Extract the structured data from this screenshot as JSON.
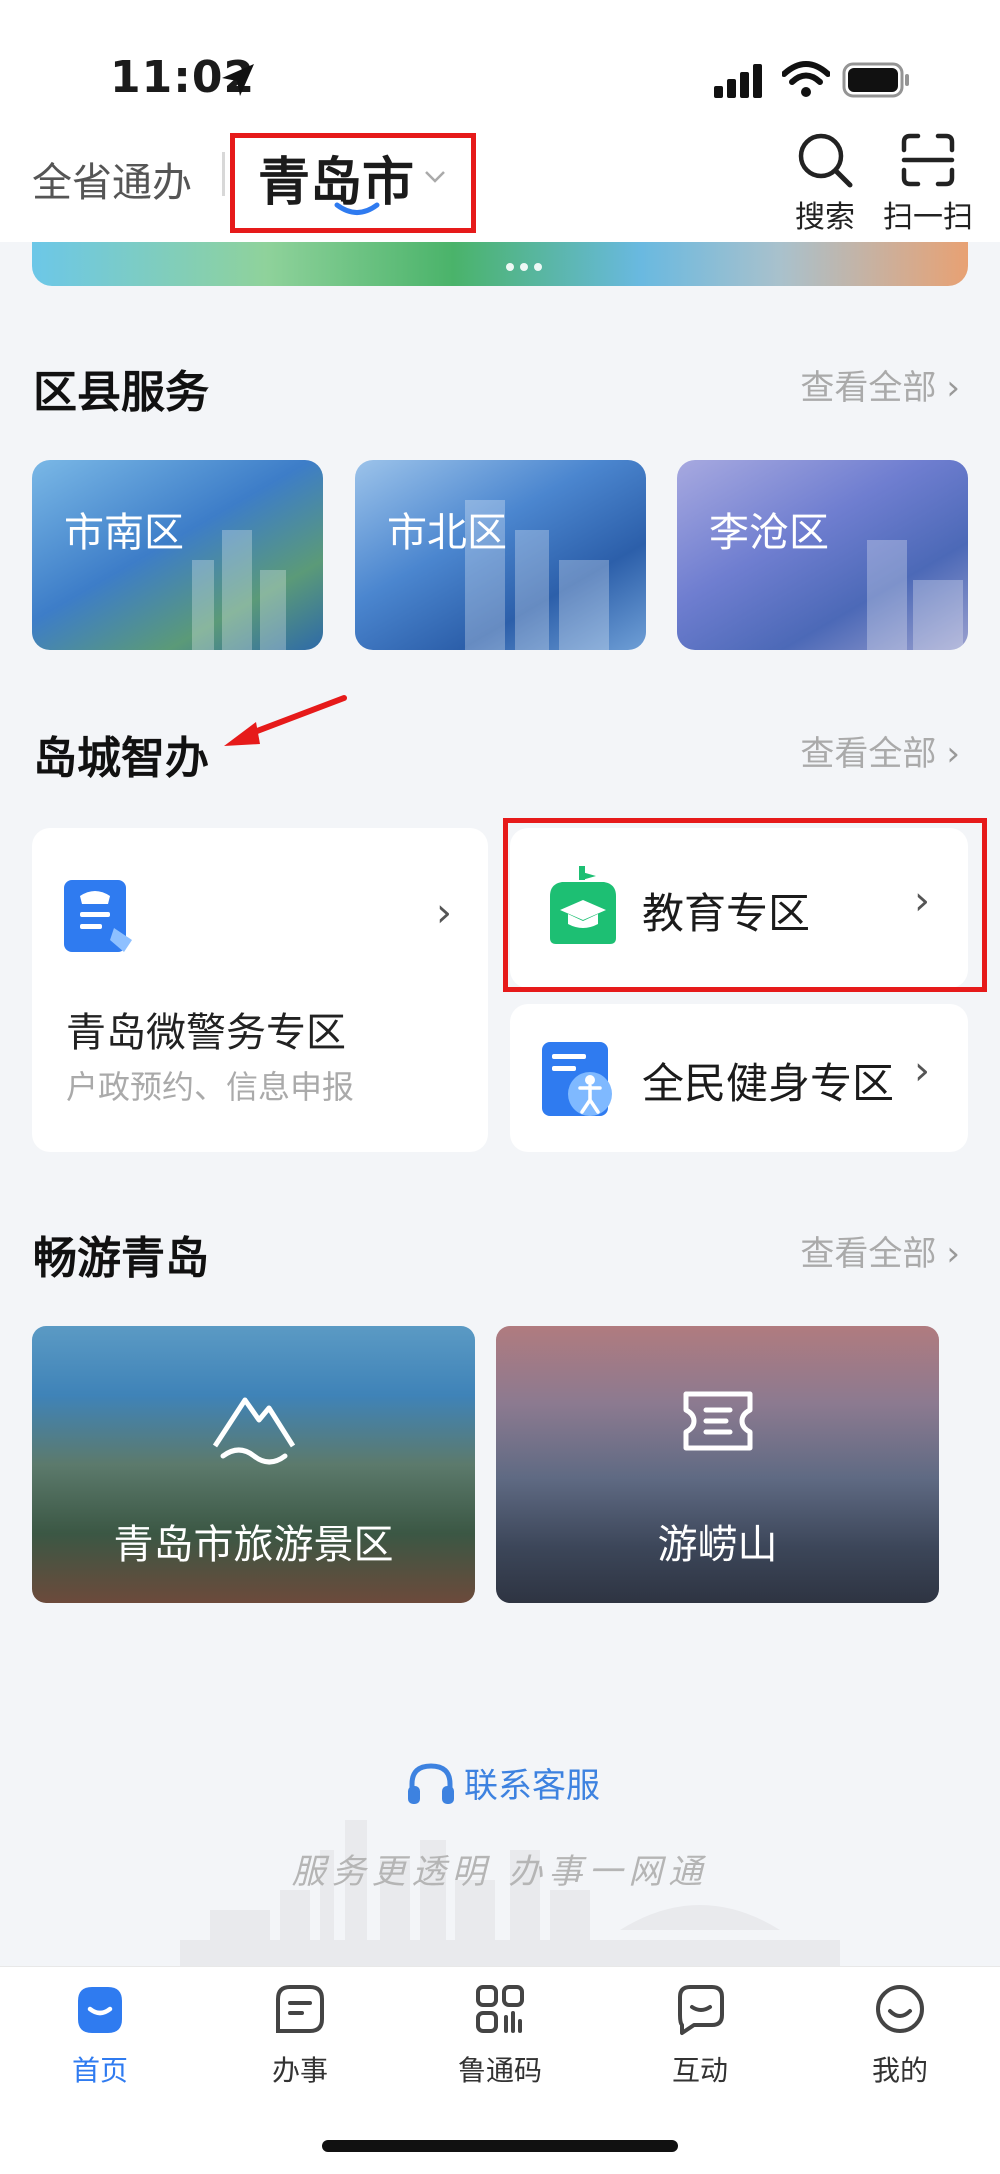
{
  "status_bar": {
    "time": "11:02"
  },
  "top_nav": {
    "province_tab": "全省通办",
    "city_tab": "青岛市",
    "search_label": "搜索",
    "scan_label": "扫一扫"
  },
  "district_section": {
    "title": "区县服务",
    "more": "查看全部",
    "items": [
      {
        "label": "市南区"
      },
      {
        "label": "市北区"
      },
      {
        "label": "李沧区"
      }
    ]
  },
  "zhiban_section": {
    "title": "岛城智办",
    "more": "查看全部",
    "police": {
      "title": "青岛微警务专区",
      "subtitle": "户政预约、信息申报"
    },
    "education": {
      "label": "教育专区"
    },
    "fitness": {
      "label": "全民健身专区"
    }
  },
  "tour_section": {
    "title": "畅游青岛",
    "more": "查看全部",
    "items": [
      {
        "label": "青岛市旅游景区"
      },
      {
        "label": "游崂山"
      }
    ]
  },
  "footer": {
    "service": "联系客服",
    "slogan": "服务更透明 办事一网通"
  },
  "tab_bar": {
    "items": [
      {
        "label": "首页",
        "icon": "home-icon",
        "active": true
      },
      {
        "label": "办事",
        "icon": "service-icon",
        "active": false
      },
      {
        "label": "鲁通码",
        "icon": "qr-code-icon",
        "active": false
      },
      {
        "label": "互动",
        "icon": "chat-icon",
        "active": false
      },
      {
        "label": "我的",
        "icon": "profile-icon",
        "active": false
      }
    ]
  },
  "colors": {
    "accent": "#2f7bf0",
    "annotation_red": "#e61a1a",
    "background": "#f3f5f8"
  }
}
